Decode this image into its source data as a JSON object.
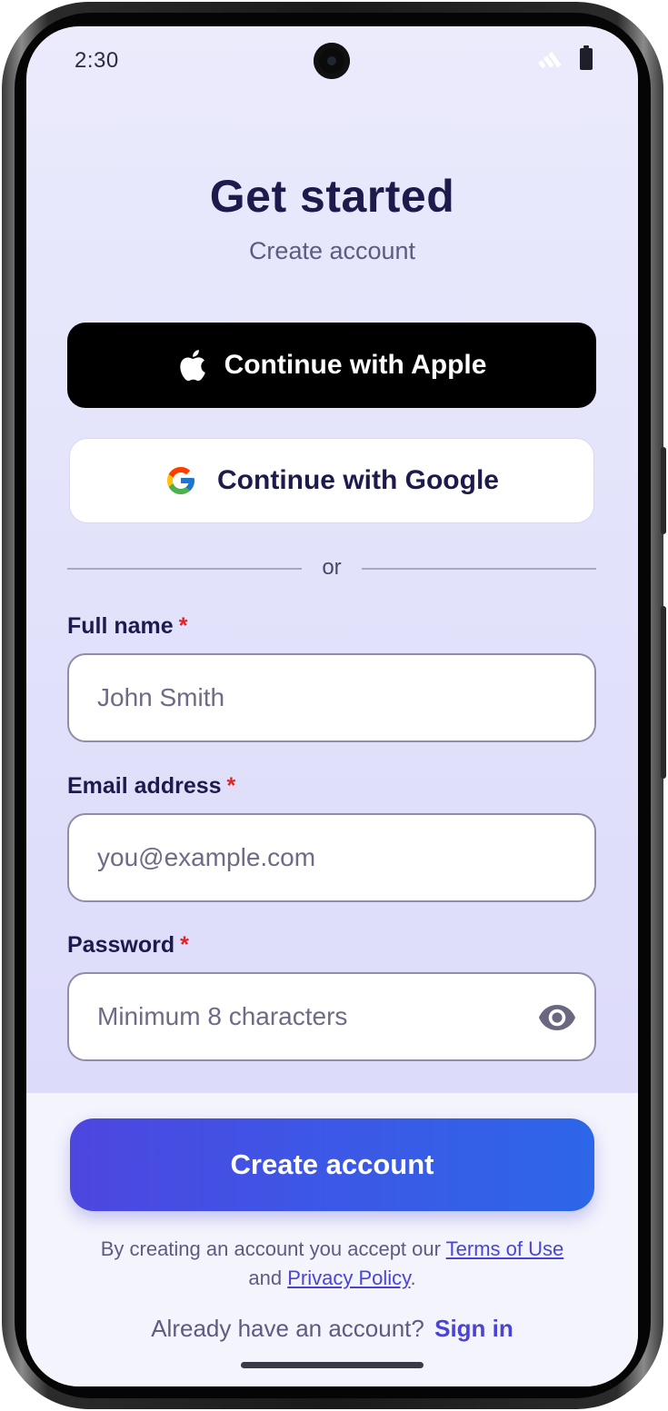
{
  "status_bar": {
    "time": "2:30",
    "icons": [
      "signal-icon",
      "battery-icon"
    ]
  },
  "header": {
    "title": "Get started",
    "subtitle": "Create account"
  },
  "social": {
    "apple_label": "Continue with Apple",
    "google_label": "Continue with Google"
  },
  "divider": {
    "label": "or"
  },
  "form": {
    "full_name": {
      "label": "Full name",
      "required_mark": "*",
      "value": "",
      "placeholder": "John Smith"
    },
    "email": {
      "label": "Email address",
      "required_mark": "*",
      "value": "",
      "placeholder": "you@example.com"
    },
    "password": {
      "label": "Password",
      "required_mark": "*",
      "value": "",
      "placeholder": "Minimum 8 characters",
      "toggle_icon": "eye-icon"
    }
  },
  "actions": {
    "create_label": "Create account"
  },
  "legal": {
    "prefix": "By creating an account you accept our",
    "terms_link": "Terms of Use",
    "middle": "and",
    "privacy_link": "Privacy Policy",
    "suffix": "."
  },
  "signin": {
    "prompt": "Already have an account?",
    "link": "Sign in"
  },
  "colors": {
    "accent": "#4a44d6",
    "title": "#1d1b4b",
    "required": "#e02424",
    "button_gradient_start": "#4d46df",
    "button_gradient_end": "#2d66e8"
  }
}
